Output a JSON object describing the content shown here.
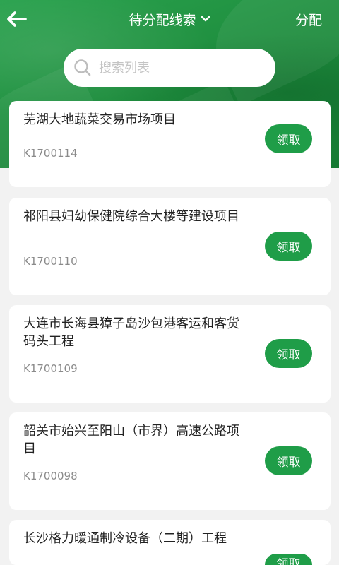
{
  "header": {
    "title": "待分配线索",
    "action_label": "分配"
  },
  "search": {
    "placeholder": "搜索列表"
  },
  "items": [
    {
      "title": "芜湖大地蔬菜交易市场项目",
      "code": "K1700114",
      "button": "领取"
    },
    {
      "title": "祁阳县妇幼保健院综合大楼等建设项目",
      "code": "K1700110",
      "button": "领取"
    },
    {
      "title": "大连市长海县獐子岛沙包港客运和客货码头工程",
      "code": "K1700109",
      "button": "领取"
    },
    {
      "title": "韶关市始兴至阳山（市界）高速公路项目",
      "code": "K1700098",
      "button": "领取"
    },
    {
      "title": "长沙格力暖通制冷设备（二期）工程",
      "code": "",
      "button": "领取"
    }
  ],
  "colors": {
    "brand_green": "#1f9d48",
    "header_green": "#1f8f3f",
    "background": "#f2f2f2"
  }
}
